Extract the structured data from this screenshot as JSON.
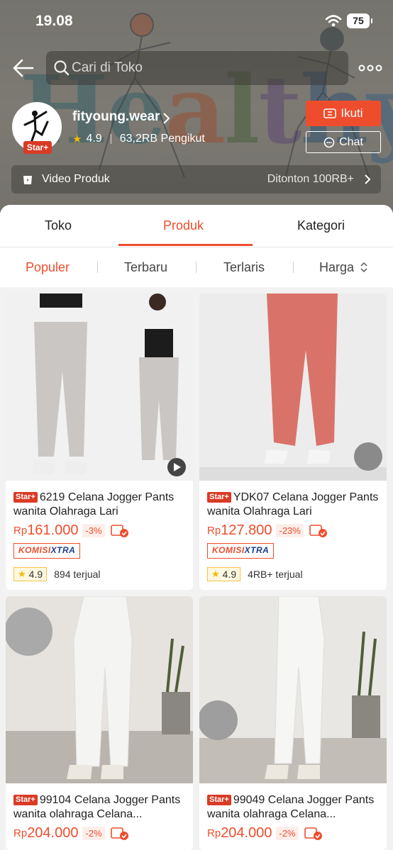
{
  "status_bar": {
    "time": "19.08",
    "battery": "75"
  },
  "search": {
    "placeholder": "Cari di Toko"
  },
  "shop": {
    "name": "fityoung.wear",
    "badge": "Star+",
    "rating": "4.9",
    "followers": "63,2RB Pengikut",
    "follow_label": "Ikuti",
    "chat_label": "Chat",
    "banner_word": [
      "H",
      "e",
      "a",
      "l",
      "t",
      "h",
      "y"
    ]
  },
  "video_row": {
    "label": "Video Produk",
    "views": "Ditonton 100RB+"
  },
  "main_tabs": [
    {
      "label": "Toko"
    },
    {
      "label": "Produk"
    },
    {
      "label": "Kategori"
    }
  ],
  "active_tab": "Produk",
  "sort_tabs": [
    {
      "label": "Populer"
    },
    {
      "label": "Terbaru"
    },
    {
      "label": "Terlaris"
    },
    {
      "label": "Harga"
    }
  ],
  "products": [
    {
      "tag": "Star+",
      "title": "6219 Celana Jogger Pants wanita Olahraga Lari",
      "currency": "Rp",
      "price": "161.000",
      "discount": "-3%",
      "komisi": [
        "KOMISI",
        "XTRA"
      ],
      "rating": "4.9",
      "sold": "894 terjual",
      "color": "#c9c6c4"
    },
    {
      "tag": "Star+",
      "title": "YDK07 Celana Jogger Pants wanita Olahraga Lari",
      "currency": "Rp",
      "price": "127.800",
      "discount": "-23%",
      "komisi": [
        "KOMISI",
        "XTRA"
      ],
      "rating": "4.9",
      "sold": "4RB+ terjual",
      "color": "#d9736a"
    },
    {
      "tag": "Star+",
      "title": "99104 Celana Jogger Pants wanita olahraga Celana...",
      "currency": "Rp",
      "price": "204.000",
      "discount": "-2%",
      "color": "#f4f4f2"
    },
    {
      "tag": "Star+",
      "title": "99049 Celana Jogger Pants wanita olahraga Celana...",
      "currency": "Rp",
      "price": "204.000",
      "discount": "-2%",
      "color": "#f4f4f2"
    }
  ],
  "colors": {
    "accent": "#ee4d2d",
    "star": "#f6b800"
  }
}
